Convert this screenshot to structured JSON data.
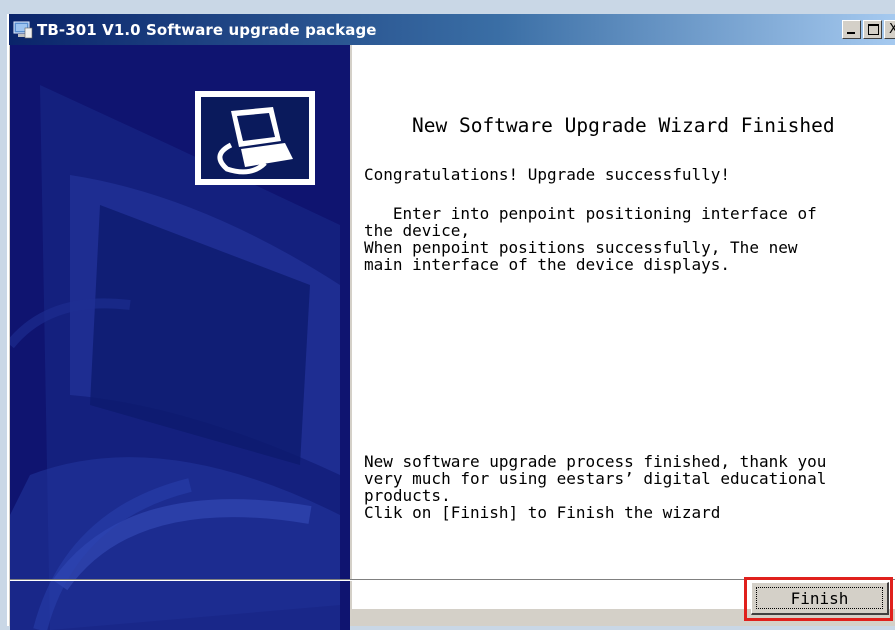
{
  "window": {
    "title": "TB-301  V1.0 Software upgrade package",
    "icon": "computer-app-icon",
    "caption_buttons": [
      "minimize",
      "maximize",
      "close"
    ],
    "close_label": "X"
  },
  "side_panel": {
    "logo_icon": "computer-monitor-icon"
  },
  "content": {
    "heading": "New Software Upgrade Wizard Finished",
    "congrats": "Congratulations! Upgrade successfully!",
    "instructions": "   Enter into penpoint positioning interface of\nthe device,\nWhen penpoint positions successfully, The new\nmain interface of the device displays.",
    "closing": "New software upgrade process finished, thank you\nvery much for using eestars’ digital educational\nproducts.\nClik on [Finish] to Finish the wizard"
  },
  "footer": {
    "finish_label": "Finish"
  },
  "colors": {
    "panel": "#0f1470",
    "highlight": "#e0201c",
    "dialog_gray": "#d4d0c8"
  }
}
